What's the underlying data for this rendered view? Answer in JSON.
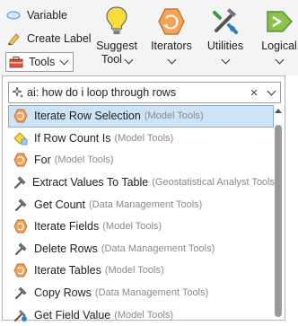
{
  "ribbon": {
    "variable_label": "Variable",
    "create_label_label": "Create Label",
    "tools_label": "Tools",
    "buttons": [
      {
        "line1": "Suggest",
        "line2": "Tool"
      },
      {
        "line1": "Iterators",
        "line2": ""
      },
      {
        "line1": "Utilities",
        "line2": ""
      },
      {
        "line1": "Logical",
        "line2": ""
      }
    ]
  },
  "search": {
    "value": "ai: how do i loop through rows",
    "clear_glyph": "×"
  },
  "results": [
    {
      "name": "Iterate Row Selection",
      "toolbox": "(Model Tools)",
      "icon": "model-iterator-icon",
      "selected": true
    },
    {
      "name": "If Row Count Is",
      "toolbox": "(Model Tools)",
      "icon": "if-condition-icon"
    },
    {
      "name": "For",
      "toolbox": "(Model Tools)",
      "icon": "model-iterator-icon"
    },
    {
      "name": "Extract Values To Table",
      "toolbox": "(Geostatistical Analyst Tools)",
      "icon": "hammer-icon"
    },
    {
      "name": "Get Count",
      "toolbox": "(Data Management Tools)",
      "icon": "hammer-icon"
    },
    {
      "name": "Iterate Fields",
      "toolbox": "(Model Tools)",
      "icon": "model-iterator-icon"
    },
    {
      "name": "Delete Rows",
      "toolbox": "(Data Management Tools)",
      "icon": "hammer-icon"
    },
    {
      "name": "Iterate Tables",
      "toolbox": "(Model Tools)",
      "icon": "model-iterator-icon"
    },
    {
      "name": "Copy Rows",
      "toolbox": "(Data Management Tools)",
      "icon": "hammer-icon"
    },
    {
      "name": "Get Field Value",
      "toolbox": "(Model Tools)",
      "icon": "model-utility-icon"
    }
  ],
  "colors": {
    "selection_bg": "#cce4f7",
    "iterator_orange": "#f3a35a",
    "lightbulb_yellow": "#f7dc3e"
  }
}
